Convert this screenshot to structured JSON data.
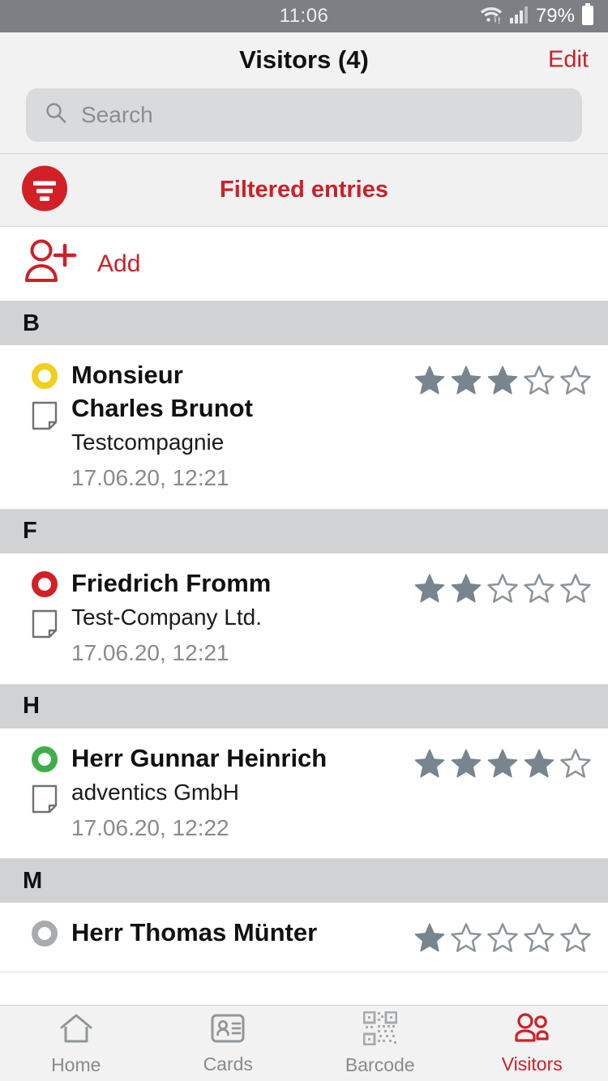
{
  "statusbar": {
    "time": "11:06",
    "battery_pct": "79%",
    "wifi_icon": "wifi-icon",
    "signal_icon": "signal-bars-icon",
    "battery_icon": "battery-icon"
  },
  "navbar": {
    "title": "Visitors (4)",
    "edit_label": "Edit"
  },
  "search": {
    "placeholder": "Search",
    "value": "",
    "icon": "search-icon"
  },
  "filterbar": {
    "label": "Filtered entries",
    "icon": "filter-icon"
  },
  "add": {
    "label": "Add",
    "icon": "add-person-icon"
  },
  "colors": {
    "accent_red": "#cc2029",
    "status_yellow": "#f2cf1c",
    "status_red": "#d31f26",
    "status_green": "#3fae49",
    "status_gray": "#a8acae",
    "star_filled": "#78858e",
    "star_empty": "#8b949a",
    "section_header_bg": "#d0d2d4",
    "statusbar_bg": "#7c7f83"
  },
  "list": {
    "sections": [
      {
        "letter": "B",
        "rows": [
          {
            "name_lines": [
              "Monsieur",
              "Charles Brunot"
            ],
            "company": "Testcompagnie",
            "date": "17.06.20, 12:21",
            "rating": 3,
            "max_rating": 5,
            "status_color": "#f2cf1c",
            "status_name": "status-dot-yellow",
            "note_icon": "note-icon"
          }
        ]
      },
      {
        "letter": "F",
        "rows": [
          {
            "name_lines": [
              "Friedrich Fromm"
            ],
            "company": "Test-Company Ltd.",
            "date": "17.06.20, 12:21",
            "rating": 2,
            "max_rating": 5,
            "status_color": "#d31f26",
            "status_name": "status-dot-red",
            "note_icon": "note-icon"
          }
        ]
      },
      {
        "letter": "H",
        "rows": [
          {
            "name_lines": [
              "Herr Gunnar Heinrich"
            ],
            "company": "adventics GmbH",
            "date": "17.06.20, 12:22",
            "rating": 4,
            "max_rating": 5,
            "status_color": "#3fae49",
            "status_name": "status-dot-green",
            "note_icon": "note-icon"
          }
        ]
      },
      {
        "letter": "M",
        "rows": [
          {
            "name_lines": [
              "Herr Thomas Münter"
            ],
            "company": "",
            "date": "",
            "rating": 1,
            "max_rating": 5,
            "status_color": "#a8acae",
            "status_name": "status-dot-gray",
            "note_icon": ""
          }
        ]
      }
    ]
  },
  "tabbar": {
    "tabs": [
      {
        "label": "Home",
        "icon": "home-icon",
        "active": false
      },
      {
        "label": "Cards",
        "icon": "id-card-icon",
        "active": false
      },
      {
        "label": "Barcode",
        "icon": "qr-code-icon",
        "active": false
      },
      {
        "label": "Visitors",
        "icon": "people-icon",
        "active": true
      }
    ]
  }
}
